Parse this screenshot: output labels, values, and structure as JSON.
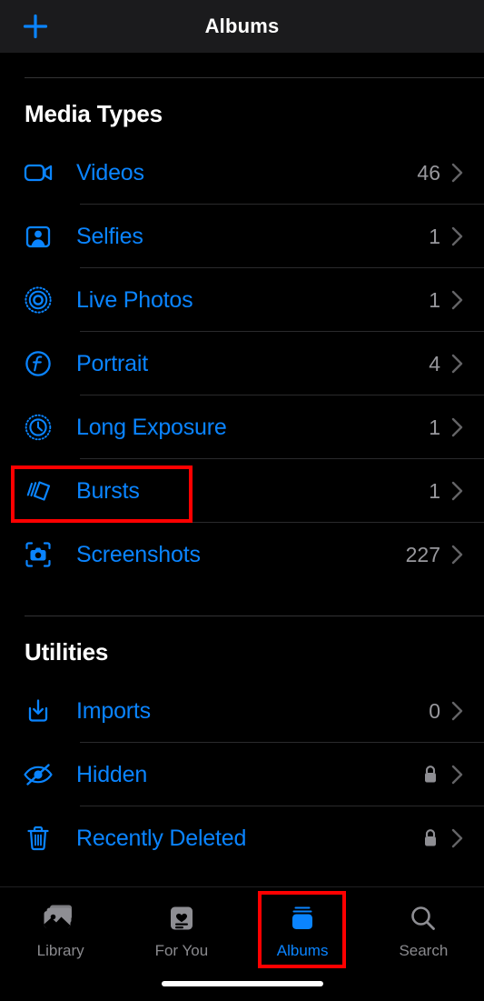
{
  "navbar": {
    "title": "Albums",
    "add_icon": "plus-icon"
  },
  "sections": [
    {
      "id": "media-types",
      "title": "Media Types",
      "rows": [
        {
          "id": "videos",
          "icon": "video-camera-icon",
          "label": "Videos",
          "count": "46",
          "locked": false
        },
        {
          "id": "selfies",
          "icon": "person-frame-icon",
          "label": "Selfies",
          "count": "1",
          "locked": false
        },
        {
          "id": "live-photos",
          "icon": "live-photo-icon",
          "label": "Live Photos",
          "count": "1",
          "locked": false
        },
        {
          "id": "portrait",
          "icon": "aperture-f-icon",
          "label": "Portrait",
          "count": "4",
          "locked": false
        },
        {
          "id": "long-exposure",
          "icon": "long-exposure-icon",
          "label": "Long Exposure",
          "count": "1",
          "locked": false
        },
        {
          "id": "bursts",
          "icon": "bursts-stack-icon",
          "label": "Bursts",
          "count": "1",
          "locked": false
        },
        {
          "id": "screenshots",
          "icon": "screenshot-icon",
          "label": "Screenshots",
          "count": "227",
          "locked": false
        }
      ]
    },
    {
      "id": "utilities",
      "title": "Utilities",
      "rows": [
        {
          "id": "imports",
          "icon": "import-tray-icon",
          "label": "Imports",
          "count": "0",
          "locked": false
        },
        {
          "id": "hidden",
          "icon": "eye-slash-icon",
          "label": "Hidden",
          "count": "",
          "locked": true
        },
        {
          "id": "recently-deleted",
          "icon": "trash-icon",
          "label": "Recently Deleted",
          "count": "",
          "locked": true
        }
      ]
    }
  ],
  "tabbar": {
    "tabs": [
      {
        "id": "library",
        "icon": "photo-stack-icon",
        "label": "Library",
        "active": false
      },
      {
        "id": "for-you",
        "icon": "for-you-card-icon",
        "label": "For You",
        "active": false
      },
      {
        "id": "albums",
        "icon": "albums-icon",
        "label": "Albums",
        "active": true
      },
      {
        "id": "search",
        "icon": "magnifier-icon",
        "label": "Search",
        "active": false
      }
    ]
  },
  "highlights": [
    {
      "id": "bursts-row-highlight",
      "target": "bursts",
      "color": "#ff0000"
    },
    {
      "id": "albums-tab-highlight",
      "target": "albums",
      "color": "#ff0000"
    }
  ],
  "colors": {
    "accent": "#0a84ff",
    "background": "#000000",
    "navbar_background": "#1b1b1d",
    "secondary_text": "#98989d",
    "separator": "#2a2a2c",
    "highlight": "#ff0000"
  }
}
